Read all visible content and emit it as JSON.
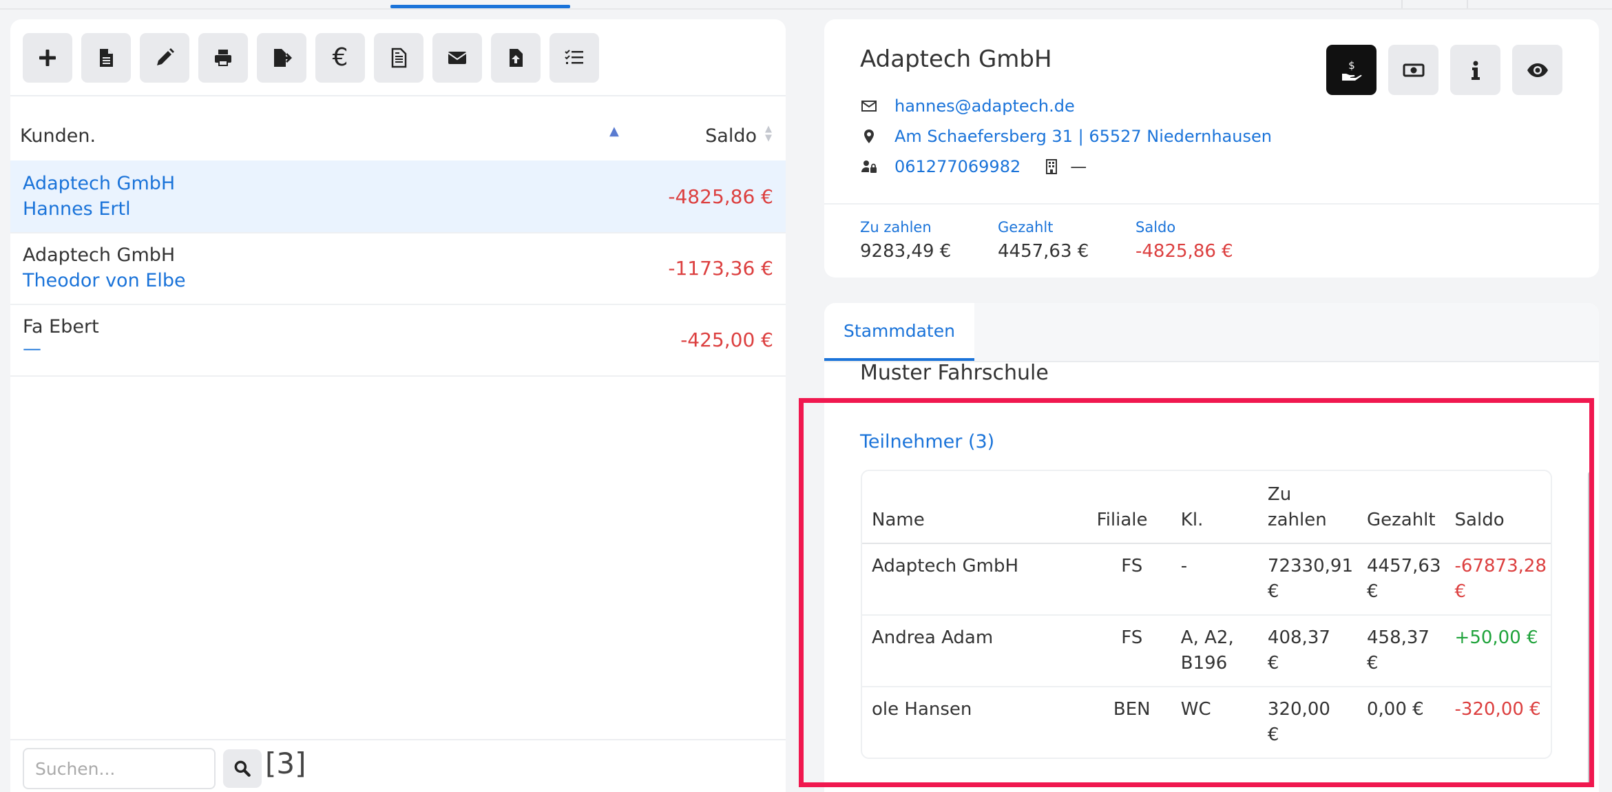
{
  "toolbar": {
    "buttons": [
      {
        "name": "add-button",
        "icon": "plus-icon"
      },
      {
        "name": "document-button",
        "icon": "file-icon"
      },
      {
        "name": "edit-button",
        "icon": "pencil-icon"
      },
      {
        "name": "print-button",
        "icon": "printer-icon"
      },
      {
        "name": "export-button",
        "icon": "file-export-icon"
      },
      {
        "name": "payment-button",
        "icon": "euro-icon"
      },
      {
        "name": "invoice-button",
        "icon": "file-invoice-icon"
      },
      {
        "name": "email-button",
        "icon": "envelope-icon"
      },
      {
        "name": "upload-button",
        "icon": "file-upload-icon"
      },
      {
        "name": "tasks-button",
        "icon": "checklist-icon"
      }
    ]
  },
  "list": {
    "header_kunden": "Kunden.",
    "header_saldo": "Saldo",
    "rows": [
      {
        "company": "Adaptech GmbH",
        "contact": "Hannes Ertl",
        "amount": "-4825,86 €",
        "selected": true
      },
      {
        "company": "Adaptech GmbH",
        "contact": "Theodor von Elbe",
        "amount": "-1173,36 €",
        "selected": false
      },
      {
        "company": "Fa Ebert",
        "contact": "—",
        "amount": "-425,00 €",
        "selected": false
      }
    ]
  },
  "search": {
    "placeholder": "Suchen...",
    "count": "[3]"
  },
  "detail": {
    "company": "Adaptech GmbH",
    "email": "hannes@adaptech.de",
    "address": "Am Schaefersberg 31 | 65527 Niedernhausen",
    "phone": "061277069982",
    "branch_value": "—",
    "summary": {
      "zu_zahlen_label": "Zu zahlen",
      "zu_zahlen_value": "9283,49 €",
      "gezahlt_label": "Gezahlt",
      "gezahlt_value": "4457,63 €",
      "saldo_label": "Saldo",
      "saldo_value": "-4825,86 €"
    }
  },
  "panel": {
    "tab": "Stammdaten",
    "organization": "Muster Fahrschule",
    "section_title": "Teilnehmer (3)",
    "table": {
      "headers": {
        "name": "Name",
        "filiale": "Filiale",
        "kl": "Kl.",
        "zu_zahlen_1": "Zu",
        "zu_zahlen_2": "zahlen",
        "gezahlt": "Gezahlt",
        "saldo": "Saldo"
      },
      "rows": [
        {
          "name": "Adaptech GmbH",
          "filiale": "FS",
          "kl": "-",
          "zu_zahlen_1": "72330,91",
          "zu_zahlen_2": "€",
          "gezahlt_1": "4457,63",
          "gezahlt_2": "€",
          "saldo_1": "-67873,28",
          "saldo_2": "€",
          "saldo_sign": "neg"
        },
        {
          "name": "Andrea Adam",
          "filiale": "FS",
          "kl": "A, A2,",
          "kl_2": "B196",
          "zu_zahlen_1": "408,37",
          "zu_zahlen_2": "€",
          "gezahlt_1": "458,37",
          "gezahlt_2": "€",
          "saldo_1": "+50,00 €",
          "saldo_2": "",
          "saldo_sign": "pos"
        },
        {
          "name": "ole Hansen",
          "filiale": "BEN",
          "kl": "WC",
          "zu_zahlen_1": "320,00",
          "zu_zahlen_2": "€",
          "gezahlt_1": "0,00 €",
          "gezahlt_2": "",
          "saldo_1": "-320,00 €",
          "saldo_2": "",
          "saldo_sign": "neg"
        }
      ]
    }
  },
  "colors": {
    "accent": "#1a73d9",
    "negative": "#dc3f3f",
    "positive": "#1fa33b",
    "highlight": "#f0184f"
  }
}
